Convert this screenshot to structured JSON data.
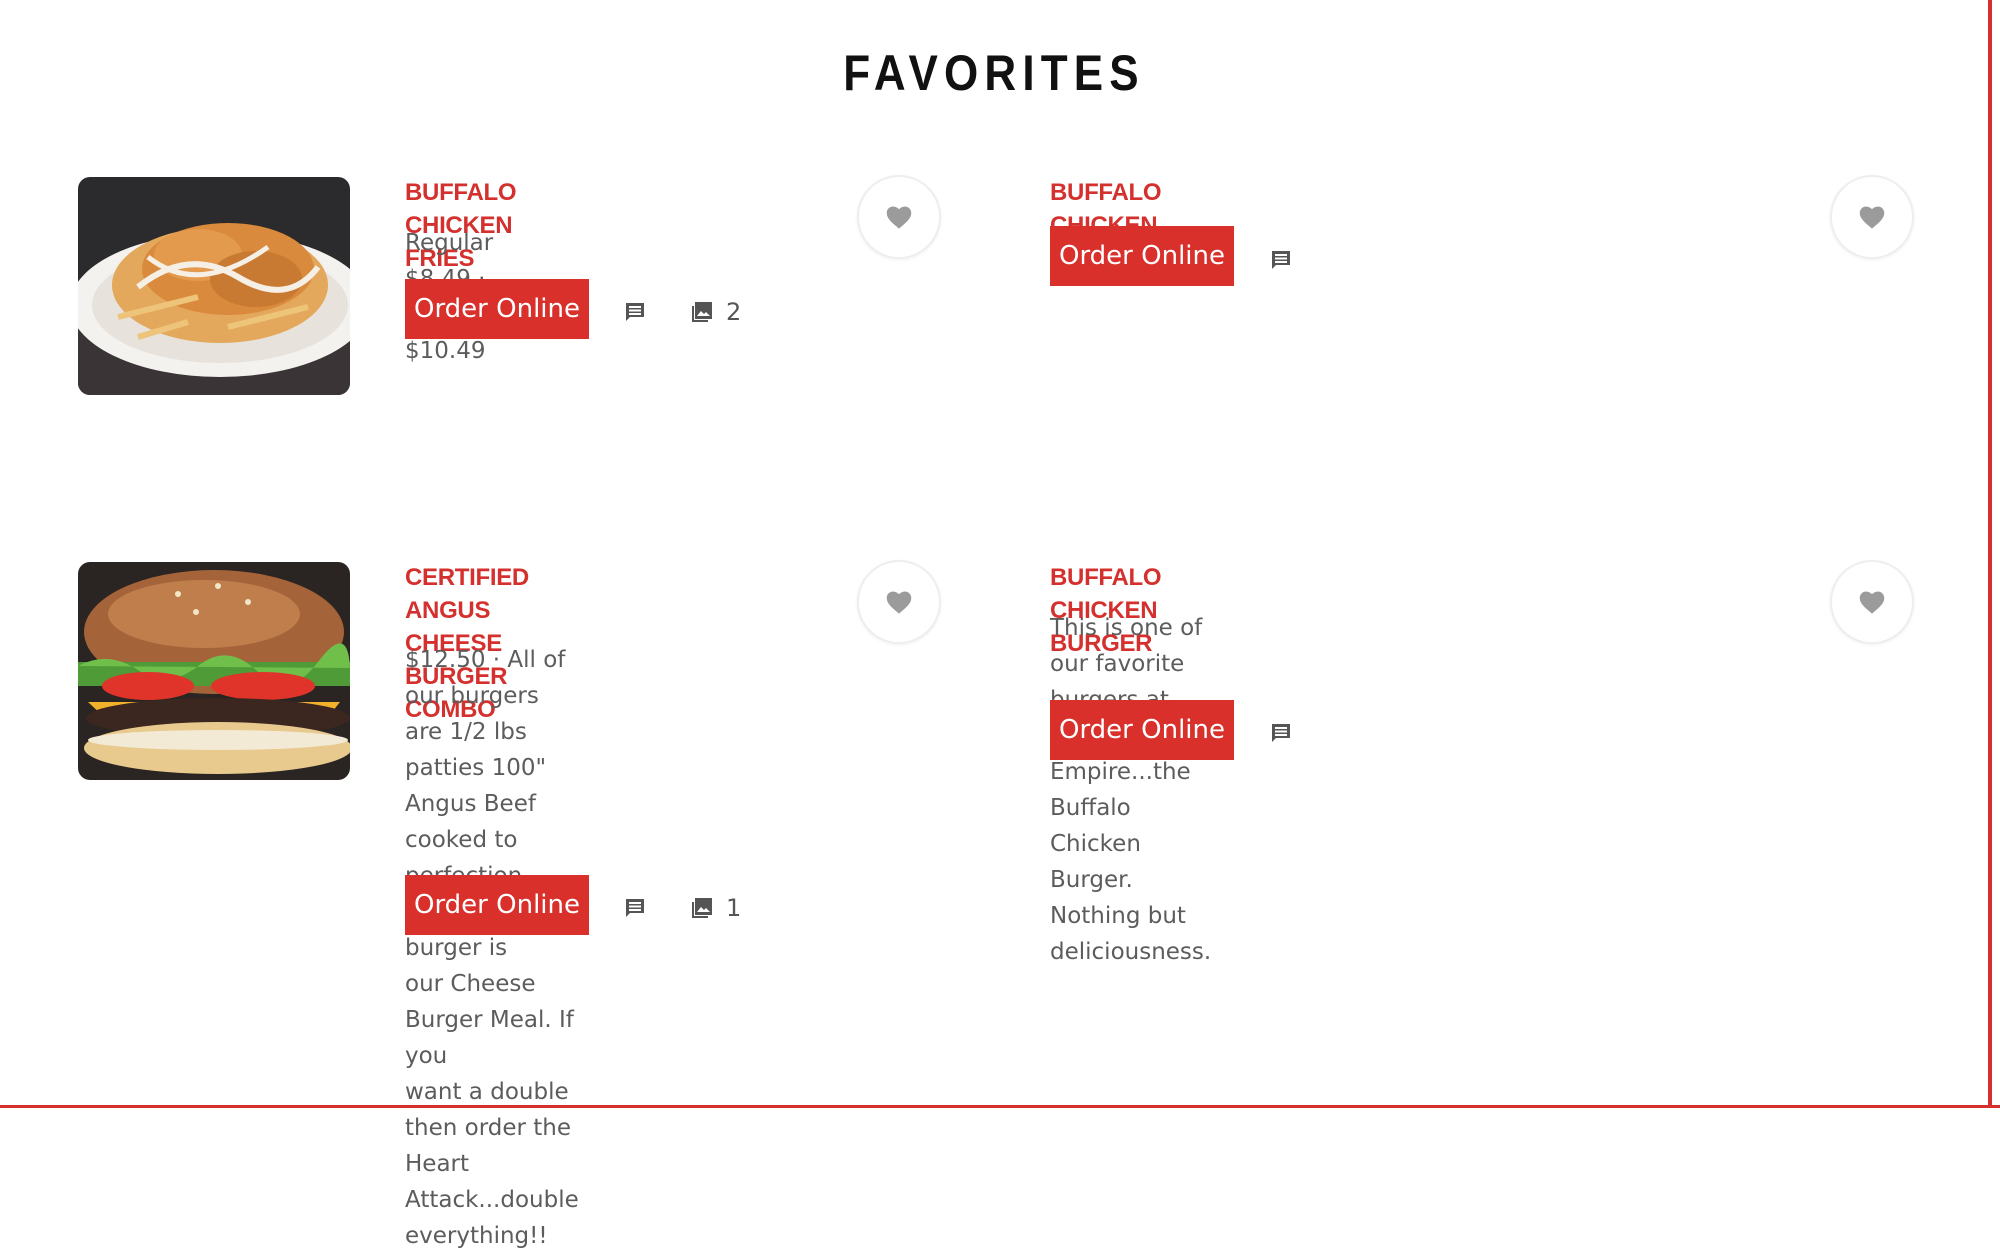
{
  "section": {
    "title": "FAVORITES"
  },
  "colors": {
    "accent": "#d9302c",
    "text": "#5c5c5c",
    "icon": "#555555",
    "heart": "#9b9b9b"
  },
  "items": [
    {
      "name": "BUFFALO CHICKEN FRIES",
      "description": "Regular $8.49 · Large $10.49",
      "order_label": "Order Online",
      "photo_count": "2",
      "icons": [
        "comment-icon",
        "photo-icon",
        "heart-icon"
      ]
    },
    {
      "name": "BUFFALO CHICKEN STIXS",
      "order_label": "Order Online",
      "icons": [
        "comment-icon",
        "heart-icon"
      ]
    },
    {
      "name_lines": [
        "CERTIFIED ANGUS CHEESE BURGER",
        "COMBO"
      ],
      "description_lines": [
        "$12.50 · All of our burgers are 1/2 lbs",
        "patties 100\" Angus Beef cooked to",
        "perfection. Most popular burger is",
        "our Cheese Burger Meal. If you",
        "want a double then order the Heart",
        "Attack...double everything!!"
      ],
      "order_label": "Order Online",
      "photo_count": "1",
      "icons": [
        "comment-icon",
        "photo-icon",
        "heart-icon"
      ]
    },
    {
      "name": "BUFFALO CHICKEN BURGER",
      "description_lines": [
        "This is one of our favorite burgers at Wings Empire...the Buffalo",
        "Chicken Burger. Nothing but deliciousness."
      ],
      "order_label": "Order Online",
      "icons": [
        "comment-icon",
        "heart-icon"
      ]
    }
  ]
}
